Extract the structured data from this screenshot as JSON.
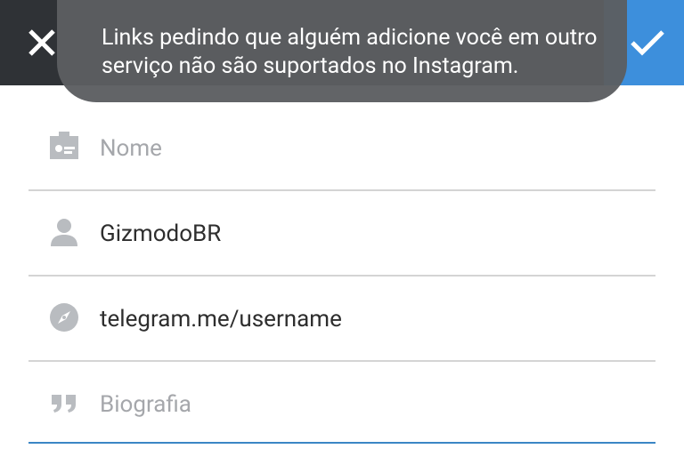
{
  "toolbar": {
    "close_label": "Fechar",
    "confirm_label": "Concluir"
  },
  "toast": {
    "message": "Links pedindo que alguém adicione você em outro serviço não são suportados no Instagram."
  },
  "form": {
    "name": {
      "value": "",
      "placeholder": "Nome",
      "icon": "id-card-icon"
    },
    "username": {
      "value": "GizmodoBR",
      "placeholder": "",
      "icon": "person-icon"
    },
    "website": {
      "value": "telegram.me/username",
      "placeholder": "",
      "icon": "compass-icon"
    },
    "bio": {
      "value": "",
      "placeholder": "Biografia",
      "icon": "quote-icon"
    }
  },
  "colors": {
    "toolbar": "#2f3236",
    "accent": "#3d8fdc",
    "toast_bg": "#5c5e61",
    "active_underline": "#3b86c5",
    "divider": "#d4d4d4"
  }
}
